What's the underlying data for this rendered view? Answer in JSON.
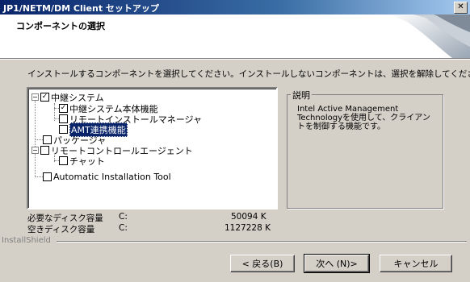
{
  "window": {
    "title": "JP1/NETM/DM Client セットアップ",
    "close_glyph": "✕"
  },
  "header": {
    "heading": "コンポーネントの選択"
  },
  "instruction": "インストールするコンポーネントを選択してください。インストールしないコンポーネントは、選択を解除してください。",
  "tree": {
    "items": [
      {
        "label": "中継システム",
        "checked": true
      },
      {
        "label": "中継システム本体機能",
        "checked": true
      },
      {
        "label": "リモートインストールマネージャ",
        "checked": false
      },
      {
        "label": "AMT連携機能",
        "checked": false,
        "selected": true
      },
      {
        "label": "パッケージャ",
        "checked": false
      },
      {
        "label": "リモートコントロールエージェント",
        "checked": false
      },
      {
        "label": "チャット",
        "checked": false
      },
      {
        "label": "Automatic Installation Tool",
        "checked": false
      }
    ]
  },
  "description": {
    "legend": "説明",
    "text": "Intel Active Management Technologyを使用して、クライアントを制御する機能です。"
  },
  "disk": {
    "required_label": "必要なディスク容量",
    "required_drive": "C:",
    "required_value": "50094 K",
    "free_label": "空きディスク容量",
    "free_drive": "C:",
    "free_value": "1127228 K"
  },
  "footer": {
    "brand": "InstallShield"
  },
  "buttons": {
    "back": "< 戻る(B)",
    "next": "次へ (N)>",
    "cancel": "キャンセル"
  },
  "colors": {
    "title_bar": "#0a246a",
    "selection": "#0a246a",
    "dialog_bg": "#d4d0c8"
  }
}
